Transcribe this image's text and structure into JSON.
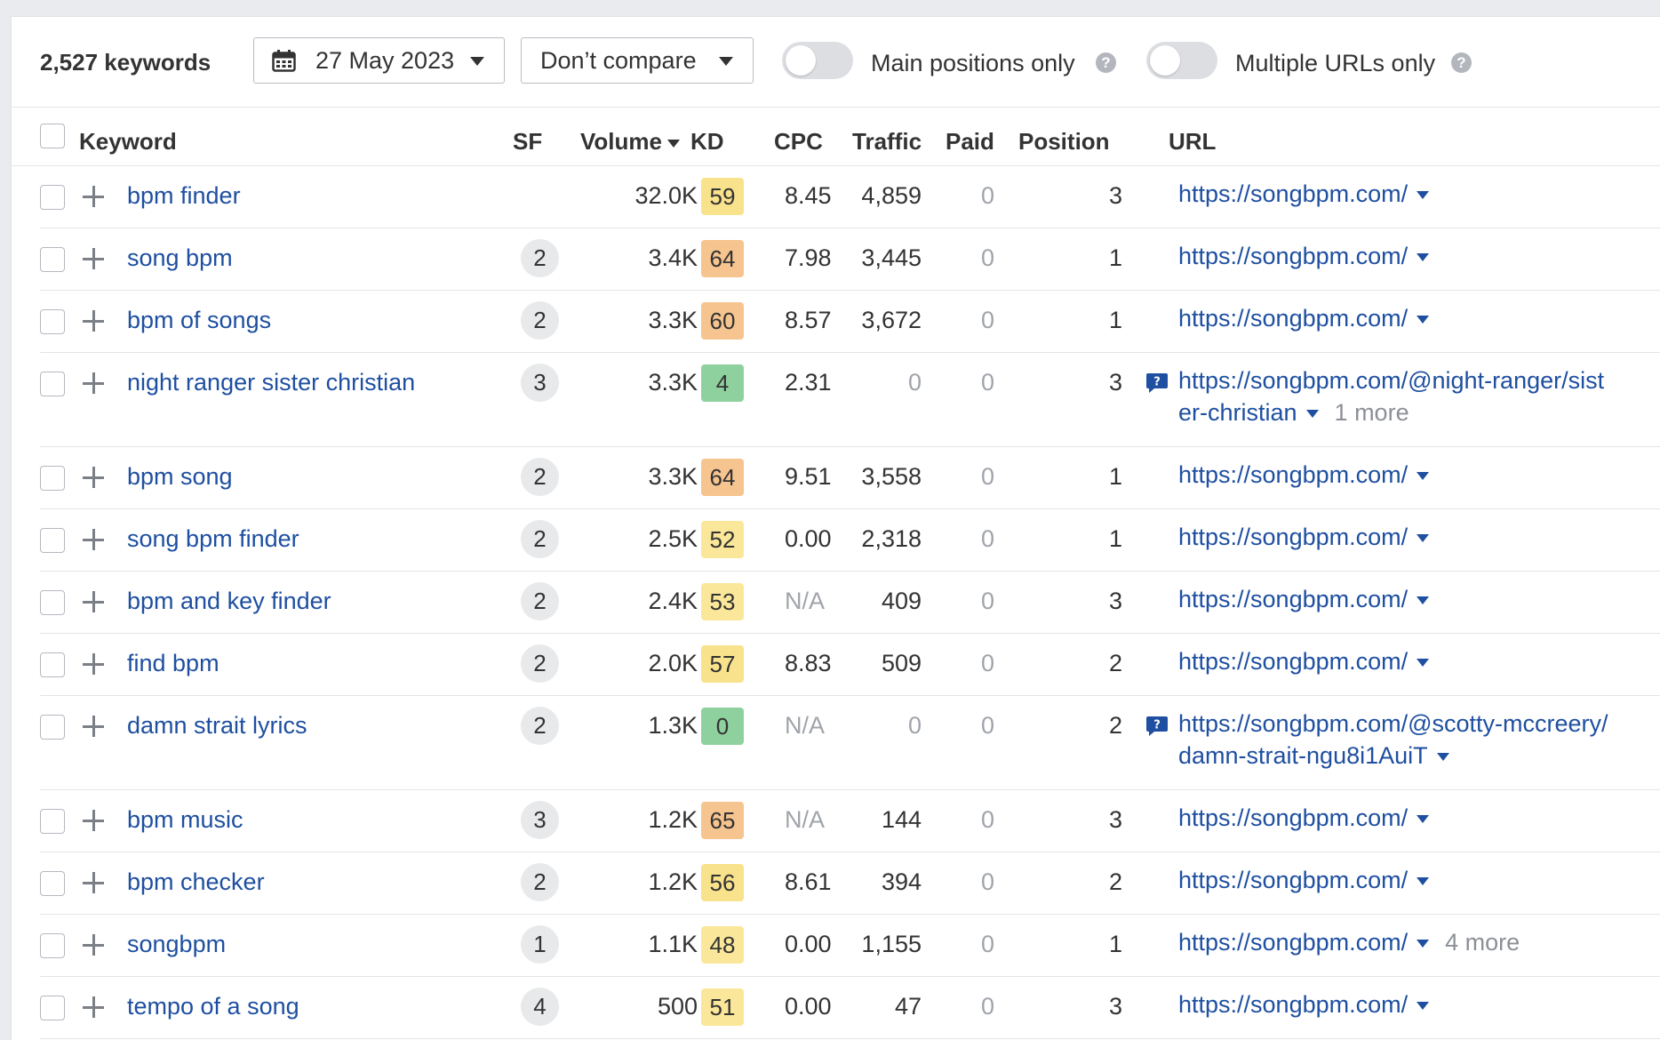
{
  "toolbar": {
    "keyword_count": "2,527 keywords",
    "date_label": "27 May 2023",
    "compare_label": "Don’t compare",
    "main_positions_label": "Main positions only",
    "multiple_urls_label": "Multiple URLs only",
    "help_glyph": "?"
  },
  "header": {
    "keyword": "Keyword",
    "sf": "SF",
    "volume": "Volume",
    "kd": "KD",
    "cpc": "CPC",
    "traffic": "Traffic",
    "paid": "Paid",
    "position": "Position",
    "url": "URL"
  },
  "colors": {
    "link": "#1e4fa0",
    "kd_green": "#8fd19e",
    "kd_yellow": "#f8e28c",
    "kd_orange": "#f6c48f",
    "kd_light_yellow": "#fbe79a"
  },
  "rows": [
    {
      "keyword": "bpm finder",
      "sf": "",
      "volume": "32.0K",
      "kd": "59",
      "kd_color": "#f8e28c",
      "cpc": "8.45",
      "traffic": "4,859",
      "paid": "0",
      "position": "3",
      "url": "https://songbpm.com/",
      "url2": "",
      "more": "",
      "chat": false
    },
    {
      "keyword": "song bpm",
      "sf": "2",
      "volume": "3.4K",
      "kd": "64",
      "kd_color": "#f6c48f",
      "cpc": "7.98",
      "traffic": "3,445",
      "paid": "0",
      "position": "1",
      "url": "https://songbpm.com/",
      "url2": "",
      "more": "",
      "chat": false
    },
    {
      "keyword": "bpm of songs",
      "sf": "2",
      "volume": "3.3K",
      "kd": "60",
      "kd_color": "#f6c48f",
      "cpc": "8.57",
      "traffic": "3,672",
      "paid": "0",
      "position": "1",
      "url": "https://songbpm.com/",
      "url2": "",
      "more": "",
      "chat": false
    },
    {
      "keyword": "night ranger sister christian",
      "sf": "3",
      "volume": "3.3K",
      "kd": "4",
      "kd_color": "#8fd19e",
      "cpc": "2.31",
      "traffic": "0",
      "paid": "0",
      "position": "3",
      "url": "https://songbpm.com/@night-ranger/sist",
      "url2": "er-christian",
      "more": "1 more",
      "chat": true
    },
    {
      "keyword": "bpm song",
      "sf": "2",
      "volume": "3.3K",
      "kd": "64",
      "kd_color": "#f6c48f",
      "cpc": "9.51",
      "traffic": "3,558",
      "paid": "0",
      "position": "1",
      "url": "https://songbpm.com/",
      "url2": "",
      "more": "",
      "chat": false
    },
    {
      "keyword": "song bpm finder",
      "sf": "2",
      "volume": "2.5K",
      "kd": "52",
      "kd_color": "#fbe79a",
      "cpc": "0.00",
      "traffic": "2,318",
      "paid": "0",
      "position": "1",
      "url": "https://songbpm.com/",
      "url2": "",
      "more": "",
      "chat": false
    },
    {
      "keyword": "bpm and key finder",
      "sf": "2",
      "volume": "2.4K",
      "kd": "53",
      "kd_color": "#fbe79a",
      "cpc": "N/A",
      "traffic": "409",
      "paid": "0",
      "position": "3",
      "url": "https://songbpm.com/",
      "url2": "",
      "more": "",
      "chat": false
    },
    {
      "keyword": "find bpm",
      "sf": "2",
      "volume": "2.0K",
      "kd": "57",
      "kd_color": "#f8e28c",
      "cpc": "8.83",
      "traffic": "509",
      "paid": "0",
      "position": "2",
      "url": "https://songbpm.com/",
      "url2": "",
      "more": "",
      "chat": false
    },
    {
      "keyword": "damn strait lyrics",
      "sf": "2",
      "volume": "1.3K",
      "kd": "0",
      "kd_color": "#8fd19e",
      "cpc": "N/A",
      "traffic": "0",
      "paid": "0",
      "position": "2",
      "url": "https://songbpm.com/@scotty-mccreery/",
      "url2": "damn-strait-ngu8i1AuiT",
      "more": "",
      "chat": true
    },
    {
      "keyword": "bpm music",
      "sf": "3",
      "volume": "1.2K",
      "kd": "65",
      "kd_color": "#f6c48f",
      "cpc": "N/A",
      "traffic": "144",
      "paid": "0",
      "position": "3",
      "url": "https://songbpm.com/",
      "url2": "",
      "more": "",
      "chat": false
    },
    {
      "keyword": "bpm checker",
      "sf": "2",
      "volume": "1.2K",
      "kd": "56",
      "kd_color": "#f8e28c",
      "cpc": "8.61",
      "traffic": "394",
      "paid": "0",
      "position": "2",
      "url": "https://songbpm.com/",
      "url2": "",
      "more": "",
      "chat": false
    },
    {
      "keyword": "songbpm",
      "sf": "1",
      "volume": "1.1K",
      "kd": "48",
      "kd_color": "#fbe79a",
      "cpc": "0.00",
      "traffic": "1,155",
      "paid": "0",
      "position": "1",
      "url": "https://songbpm.com/",
      "url2": "",
      "more": "4 more",
      "chat": false
    },
    {
      "keyword": "tempo of a song",
      "sf": "4",
      "volume": "500",
      "kd": "51",
      "kd_color": "#fbe79a",
      "cpc": "0.00",
      "traffic": "47",
      "paid": "0",
      "position": "3",
      "url": "https://songbpm.com/",
      "url2": "",
      "more": "",
      "chat": false
    }
  ]
}
